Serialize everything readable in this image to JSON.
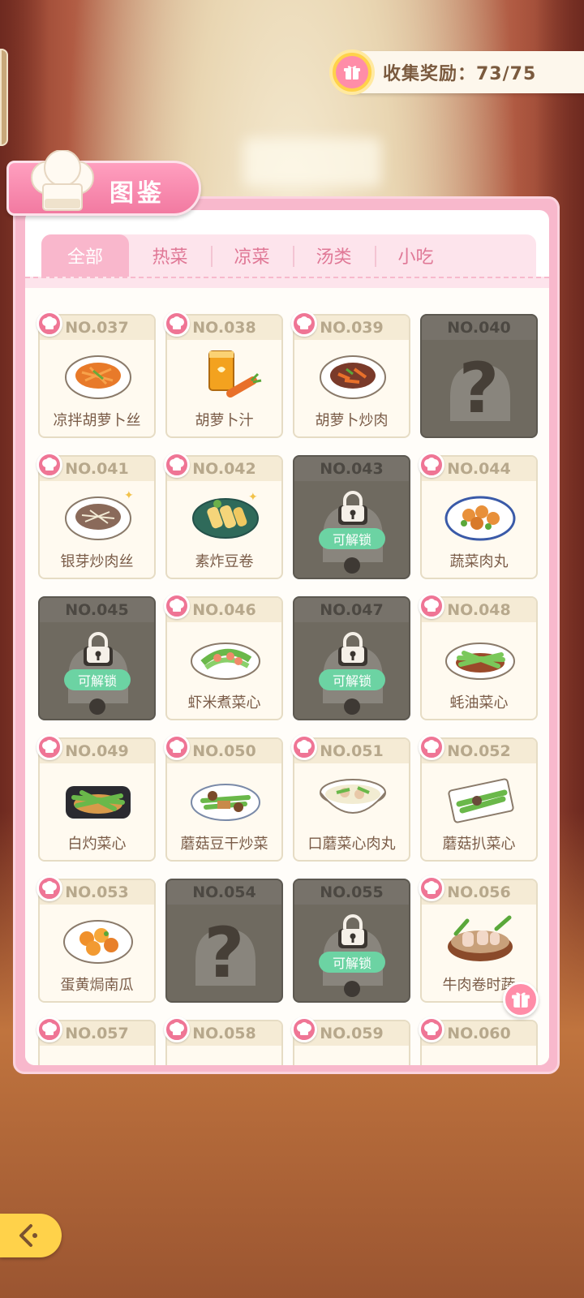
{
  "reward": {
    "label": "收集奖励：73/75"
  },
  "title": "图鉴",
  "tabs": [
    {
      "label": "全部",
      "active": true
    },
    {
      "label": "热菜",
      "active": false
    },
    {
      "label": "凉菜",
      "active": false
    },
    {
      "label": "汤类",
      "active": false
    },
    {
      "label": "小吃",
      "active": false
    }
  ],
  "unlock_label": "可解锁",
  "colors": {
    "accent_pink": "#f27aa1",
    "unlock_green": "#6cd3a3",
    "gold": "#ffd24a"
  },
  "cards": [
    {
      "no": "NO.037",
      "name": "凉拌胡萝卜丝",
      "state": "collected",
      "dish": "carrot-salad"
    },
    {
      "no": "NO.038",
      "name": "胡萝卜汁",
      "state": "collected",
      "dish": "carrot-juice"
    },
    {
      "no": "NO.039",
      "name": "胡萝卜炒肉",
      "state": "collected",
      "dish": "carrot-pork"
    },
    {
      "no": "NO.040",
      "name": "",
      "state": "unknown",
      "dish": ""
    },
    {
      "no": "NO.041",
      "name": "银芽炒肉丝",
      "state": "collected",
      "dish": "sprout-pork"
    },
    {
      "no": "NO.042",
      "name": "素炸豆卷",
      "state": "collected",
      "dish": "tofu-roll"
    },
    {
      "no": "NO.043",
      "name": "",
      "state": "unlockable",
      "dish": ""
    },
    {
      "no": "NO.044",
      "name": "蔬菜肉丸",
      "state": "collected",
      "dish": "meatballs"
    },
    {
      "no": "NO.045",
      "name": "",
      "state": "unlockable",
      "dish": ""
    },
    {
      "no": "NO.046",
      "name": "虾米煮菜心",
      "state": "collected",
      "dish": "shrimp-greens"
    },
    {
      "no": "NO.047",
      "name": "",
      "state": "unlockable",
      "dish": ""
    },
    {
      "no": "NO.048",
      "name": "蚝油菜心",
      "state": "collected",
      "dish": "oyster-greens"
    },
    {
      "no": "NO.049",
      "name": "白灼菜心",
      "state": "collected",
      "dish": "blanched-greens"
    },
    {
      "no": "NO.050",
      "name": "蘑菇豆干炒菜",
      "state": "collected",
      "dish": "mushroom-tofu"
    },
    {
      "no": "NO.051",
      "name": "口蘑菜心肉丸",
      "state": "collected",
      "dish": "meatball-soup"
    },
    {
      "no": "NO.052",
      "name": "蘑菇扒菜心",
      "state": "collected",
      "dish": "mushroom-greens"
    },
    {
      "no": "NO.053",
      "name": "蛋黄焗南瓜",
      "state": "collected",
      "dish": "pumpkin"
    },
    {
      "no": "NO.054",
      "name": "",
      "state": "unknown",
      "dish": ""
    },
    {
      "no": "NO.055",
      "name": "",
      "state": "unlockable",
      "dish": ""
    },
    {
      "no": "NO.056",
      "name": "牛肉卷时蔬",
      "state": "collected",
      "dish": "beef-roll"
    },
    {
      "no": "NO.057",
      "name": "",
      "state": "collected",
      "dish": ""
    },
    {
      "no": "NO.058",
      "name": "",
      "state": "collected",
      "dish": ""
    },
    {
      "no": "NO.059",
      "name": "",
      "state": "collected",
      "dish": ""
    },
    {
      "no": "NO.060",
      "name": "",
      "state": "collected",
      "dish": ""
    }
  ]
}
